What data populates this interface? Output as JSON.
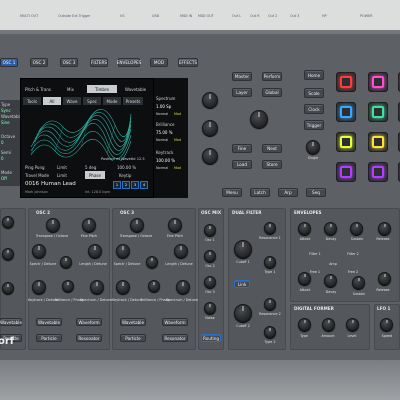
{
  "top_strip": {
    "labels": [
      "MULTI OUT",
      "Outside Ext Trigger",
      "VS",
      "USB",
      "MIDI IN",
      "MIDI OUT",
      "Out L",
      "Out R",
      "Out 2",
      "Out 3",
      "HP",
      "POWER"
    ]
  },
  "tabs": [
    "OSC 1",
    "OSC 2",
    "OSC 3",
    "FILTERS",
    "ENVELOPES",
    "MOD",
    "EFFECTS"
  ],
  "screen": {
    "header": [
      "Pitch & Trans",
      "Mix",
      "Timbre",
      "Wavetable"
    ],
    "subtabs": [
      "Tools",
      "All",
      "Wave",
      "Spec",
      "Mode",
      "Presets"
    ],
    "right_params": [
      "Spectrum",
      "Brilliance",
      "Keytrack"
    ],
    "right_values": [
      "1.00 Sp",
      "75.00 %",
      "100.00 %"
    ],
    "right_sub": [
      "Normal",
      "Mod",
      "Normal",
      "Mod",
      "Normal",
      "Mod"
    ],
    "waveform_values": [
      "Position ex.",
      "Wavetbl 12.5"
    ],
    "bottom_row1": [
      "Ping Pong",
      "Limit",
      "5 deg",
      "100.00 %"
    ],
    "bottom_row2": [
      "Travel Mode",
      "Limit",
      "Phase",
      "Keytip"
    ],
    "preset_number": "0016",
    "preset_name": "Human Lead",
    "preset_author": "Mark Johnson",
    "preset_info": "Int. 128.0 bpm",
    "preset_slots": [
      "1",
      "2",
      "3",
      "4"
    ],
    "left_labels": [
      "Type",
      "Wavetable",
      "Octave",
      "Semi",
      "Mode"
    ],
    "left_values": [
      "Sync",
      "Sine",
      "0",
      "0",
      "Off"
    ]
  },
  "center_buttons": {
    "row1": [
      "Master",
      "Perform"
    ],
    "row2": [
      "Layer",
      "Global"
    ],
    "row3": [
      "Fine",
      "Next"
    ],
    "row4": [
      "Load",
      "Store"
    ],
    "bottom": [
      "Menu",
      "Latch",
      "Arp",
      "Seq"
    ],
    "right": [
      "Home",
      "Scale",
      "Clock",
      "Trigger"
    ],
    "single_label": "Single"
  },
  "pads": {
    "colors": [
      "#ff3c3c",
      "#ff4fd0",
      "#ff4fd0",
      "#39a7ff",
      "#40e0a0",
      "#3c8aff",
      "#e8ff3a",
      "#ffe13a",
      "#c840ff",
      "#b040ff",
      "#b040ff",
      "#b040ff"
    ]
  },
  "sections": {
    "osc1": {
      "title": "OSC 1",
      "knobs": [
        "Transpose / Octave",
        "Fine Pitch",
        "Spectr / Detune",
        "FX / Keytrack",
        "Fine / Octave",
        "Length / Detune",
        "Brilliance / Phase",
        "Spectrum / Detune",
        "Keytrack / Pitch"
      ],
      "buttons": [
        "Wavetable",
        "Particle"
      ]
    },
    "osc2": {
      "title": "OSC 2",
      "knobs": [
        "Transpose / Octave",
        "Fine Pitch",
        "Spectr / Detune",
        "FX / Keytrack",
        "Length / Detune",
        "Keytrack / Detune",
        "Brilliance / Phase",
        "Spectrum / Detune"
      ],
      "buttons": [
        "Wavetable",
        "Particle",
        "Waveform",
        "Resonator"
      ]
    },
    "osc3": {
      "title": "OSC 3",
      "knobs": [
        "Transpose / Octave",
        "Fine Pitch",
        "Spectr / Detune",
        "FX / Keytrack",
        "Length / Detune",
        "Keytrack / Detune",
        "Brilliance / Phase",
        "Spectrum / Detune"
      ],
      "buttons": [
        "Wavetable",
        "Particle",
        "Waveform",
        "Resonator"
      ]
    },
    "osc_mix": {
      "title": "OSC MIX",
      "knobs": [
        "Osc 1",
        "Osc 2",
        "Osc 3",
        "Noise"
      ],
      "button": "Routing"
    },
    "dual_filter": {
      "title": "DUAL FILTER",
      "knobs": [
        "Cutoff 1",
        "Resonance 1",
        "Type 1",
        "Cutoff 2",
        "Resonance 2",
        "Type 2"
      ],
      "link": "Link"
    },
    "envelopes": {
      "title": "ENVELOPES",
      "knobs": [
        "Attack",
        "Decay",
        "Sustain",
        "Release",
        "Filter 1",
        "Filter 2",
        "Amp",
        "Free 1",
        "Free 2",
        "Attack",
        "Decay",
        "Sustain",
        "Release"
      ]
    },
    "digital_former": {
      "title": "DIGITAL FORMER",
      "knobs": [
        "Type",
        "Amount",
        "Level",
        "Mix"
      ]
    },
    "lfo": {
      "title": "LFO 1",
      "knobs": [
        "Speed"
      ]
    }
  },
  "brand_fragment": "orf"
}
